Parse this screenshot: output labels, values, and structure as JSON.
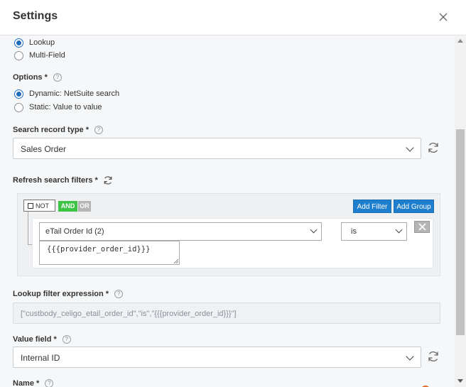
{
  "header": {
    "title": "Settings"
  },
  "mode_options": [
    {
      "label": "Lookup",
      "selected": true
    },
    {
      "label": "Multi-Field",
      "selected": false
    }
  ],
  "options": {
    "label": "Options *",
    "items": [
      {
        "label": "Dynamic: NetSuite search",
        "selected": true
      },
      {
        "label": "Static: Value to value",
        "selected": false
      }
    ]
  },
  "search_record_type": {
    "label": "Search record type *",
    "value": "Sales Order"
  },
  "refresh_filters": {
    "label": "Refresh search filters *",
    "not_label": "NOT",
    "and_label": "AND",
    "or_label": "OR",
    "add_filter_label": "Add Filter",
    "add_group_label": "Add Group",
    "field_value": "eTail Order Id (2)",
    "operator_value": "is",
    "rule_value": "{{{provider_order_id}}}"
  },
  "lookup_filter_expression": {
    "label": "Lookup filter expression *",
    "value": "[\"custbody_celigo_etail_order_id\",\"is\",\"{{{provider_order_id}}}\"]"
  },
  "value_field": {
    "label": "Value field *",
    "value": "Internal ID"
  },
  "name_field": {
    "label": "Name *"
  },
  "help_symbol": "?",
  "colors": {
    "accent": "#1f6cbd",
    "and_green": "#3ec445",
    "button_blue": "#1e7fce"
  }
}
